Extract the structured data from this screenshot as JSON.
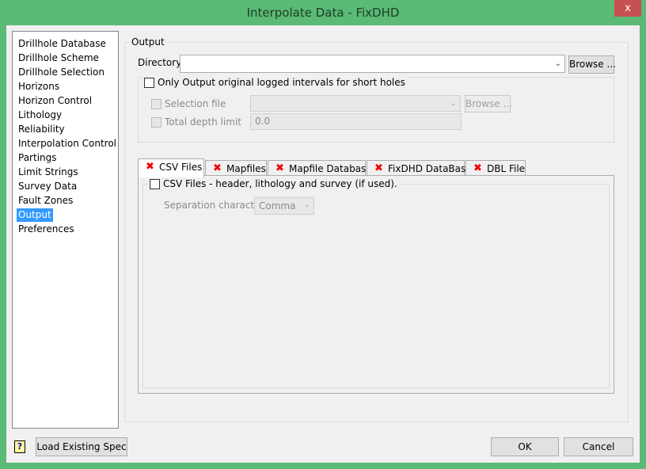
{
  "window": {
    "title": "Interpolate Data - FixDHD",
    "close_label": "x"
  },
  "sidebar": {
    "items": [
      {
        "label": "Drillhole Database"
      },
      {
        "label": "Drillhole Scheme"
      },
      {
        "label": "Drillhole Selection"
      },
      {
        "label": "Horizons"
      },
      {
        "label": "Horizon Control"
      },
      {
        "label": "Lithology"
      },
      {
        "label": "Reliability"
      },
      {
        "label": "Interpolation Control"
      },
      {
        "label": "Partings"
      },
      {
        "label": "Limit Strings"
      },
      {
        "label": "Survey Data"
      },
      {
        "label": "Fault Zones"
      },
      {
        "label": "Output",
        "selected": true
      },
      {
        "label": "Preferences"
      }
    ]
  },
  "output": {
    "group_label": "Output",
    "directory_label": "Directory",
    "directory_value": "",
    "browse_label": "Browse ...",
    "short_holes_label": "Only Output original logged intervals for short holes",
    "selection_file_label": "Selection file",
    "selection_file_value": "",
    "selection_browse_label": "Browse ...",
    "total_depth_label": "Total depth limit",
    "total_depth_value": "0.0"
  },
  "tabs": [
    {
      "label": "CSV Files",
      "active": true
    },
    {
      "label": "Mapfiles"
    },
    {
      "label": "Mapfile Database"
    },
    {
      "label": "FixDHD DataBase"
    },
    {
      "label": "DBL File"
    }
  ],
  "tab_icon": "red-x-icon",
  "csv": {
    "checkbox_label": "CSV Files - header, lithology and survey (if used).",
    "separation_label": "Separation character",
    "separation_value": "Comma"
  },
  "footer": {
    "help_icon": "help-icon",
    "load_label": "Load Existing Spec",
    "ok_label": "OK",
    "cancel_label": "Cancel"
  },
  "colors": {
    "frame": "#5aba76",
    "selected": "#3399ff",
    "close": "#c75050",
    "tab_x": "#e00000"
  }
}
